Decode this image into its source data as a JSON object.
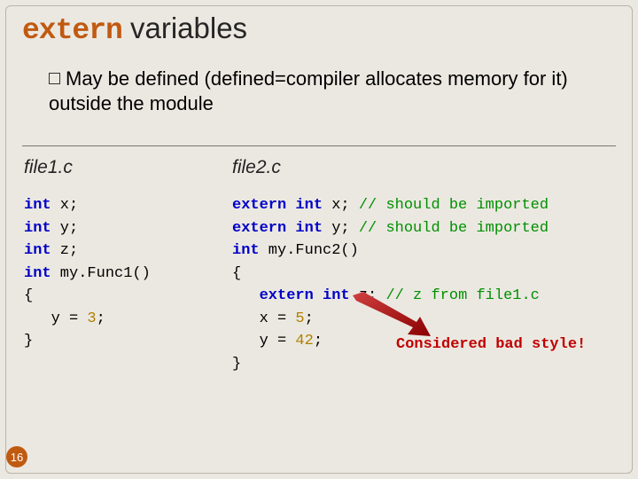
{
  "title": {
    "keyword": "extern",
    "rest": " variables"
  },
  "bullet": {
    "line1": "May be defined (defined=compiler allocates memory for it)",
    "line2": "outside the module"
  },
  "file1": {
    "name": "file1.c",
    "l1_kw": "int",
    "l1_rest": " x;",
    "l2_kw": "int",
    "l2_rest": " y;",
    "l3_kw": "int",
    "l3_rest": " z;",
    "l4_kw": "int",
    "l4_rest": " my.Func1()",
    "l5": "{",
    "l6a": "   y = ",
    "l6_num": "3",
    "l6b": ";",
    "l7": "}"
  },
  "file2": {
    "name": "file2.c",
    "l1_kw1": "extern",
    "l1_kw2": "int",
    "l1_rest": " x; ",
    "l1_cm": "// should be imported",
    "l2_kw1": "extern",
    "l2_kw2": "int",
    "l2_rest": " y; ",
    "l2_cm": "// should be imported",
    "l3_kw": "int",
    "l3_rest": " my.Func2()",
    "l4": "{",
    "l5a": "   ",
    "l5_kw1": "extern",
    "l5_kw2": "int",
    "l5_rest": " z; ",
    "l5_cm": "// z from file1.c",
    "l6a": "   x = ",
    "l6_num": "5",
    "l6b": ";",
    "l7a": "   y = ",
    "l7_num": "42",
    "l7b": ";",
    "l8": "}"
  },
  "bad_style": "Considered bad style!",
  "page_number": "16"
}
